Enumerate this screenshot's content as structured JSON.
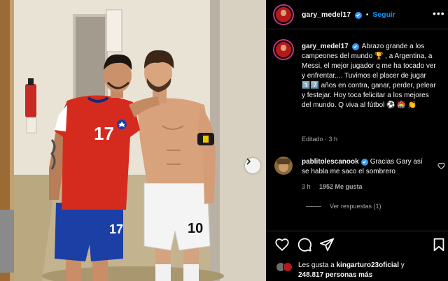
{
  "post": {
    "author": "gary_medel17",
    "follow_label": "Seguir",
    "separator": "•",
    "more_icon": "more-horizontal-icon",
    "caption_username": "gary_medel17",
    "caption": "Abrazo grande a los campeones del mundo 🏆 , a Argentina, a Messi, el mejor jugador q me ha tocado ver y enfrentar.... Tuvimos el placer de jugar 1️⃣7️⃣ años en contra, ganar, perder, pelear y festejar. Hoy toca felicitar a los mejores del mundo. Q viva al fútbol ⚽ 🏟️ 👏",
    "edited_time": "Editado · 3 h"
  },
  "photo": {
    "jersey_number_chile": "17",
    "shorts_number_chile": "17",
    "shorts_number_argentina": "10",
    "next_icon": "chevron-right-icon"
  },
  "comment": {
    "username": "pablitolescanook",
    "text": "Gracias Gary así se habla me saco el sombrero",
    "time": "3 h",
    "likes": "1952 Me gusta",
    "view_replies": "Ver respuestas (1)"
  },
  "footer": {
    "liked_by_prefix": "Les gusta a",
    "liked_by_user": "kingarturo23oficial",
    "liked_by_suffix": "y",
    "liked_count": "248.817 personas más"
  },
  "colors": {
    "accent": "#0095f6",
    "verified": "#3897f0",
    "chile_red": "#d52b1e",
    "chile_blue": "#1c3fa6",
    "background": "#000000"
  }
}
